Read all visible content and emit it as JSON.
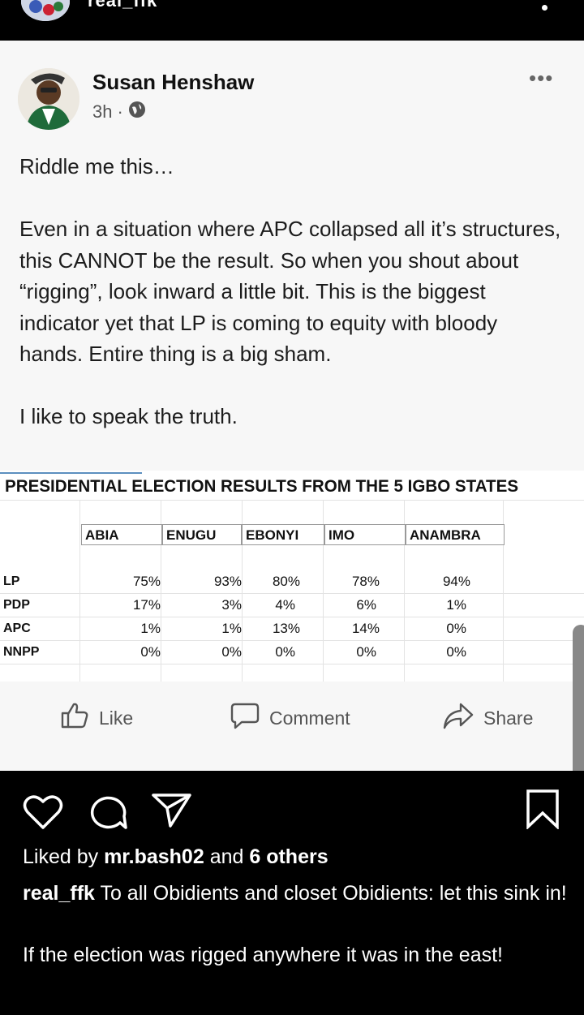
{
  "header": {
    "username": "real_ffk"
  },
  "post": {
    "author": "Susan Henshaw",
    "time": "3h",
    "dot": "·",
    "more": "•••",
    "paragraphs": [
      "Riddle me this…",
      "Even in a situation where APC collapsed all it’s structures, this CANNOT be the result. So when you shout about “rigging”, look inward a little bit. This is the biggest indicator yet that LP is coming to equity with bloody hands. Entire thing is a big sham.",
      "I like to speak the truth."
    ],
    "table": {
      "title": "PRESIDENTIAL ELECTION RESULTS FROM THE 5 IGBO STATES",
      "columns": [
        "ABIA",
        "ENUGU",
        "EBONYI",
        "IMO",
        "ANAMBRA"
      ],
      "rows": [
        {
          "party": "LP",
          "values": [
            "75%",
            "93%",
            "80%",
            "78%",
            "94%"
          ]
        },
        {
          "party": "PDP",
          "values": [
            "17%",
            "3%",
            "4%",
            "6%",
            "1%"
          ]
        },
        {
          "party": "APC",
          "values": [
            "1%",
            "1%",
            "13%",
            "14%",
            "0%"
          ]
        },
        {
          "party": "NNPP",
          "values": [
            "0%",
            "0%",
            "0%",
            "0%",
            "0%"
          ]
        }
      ]
    },
    "actions": {
      "like": "Like",
      "comment": "Comment",
      "share": "Share"
    }
  },
  "instagram": {
    "liked_prefix": "Liked by ",
    "liked_user": "mr.bash02",
    "liked_mid": " and ",
    "liked_others": "6 others",
    "caption_user": "real_ffk",
    "caption_text": " To all Obidients and closet Obidients: let this sink in!",
    "caption_text2": "If the election was rigged anywhere it was in the east!"
  },
  "colors": {
    "background": "#000000",
    "card": "#f7f7f7",
    "text": "#1c1c1c"
  }
}
